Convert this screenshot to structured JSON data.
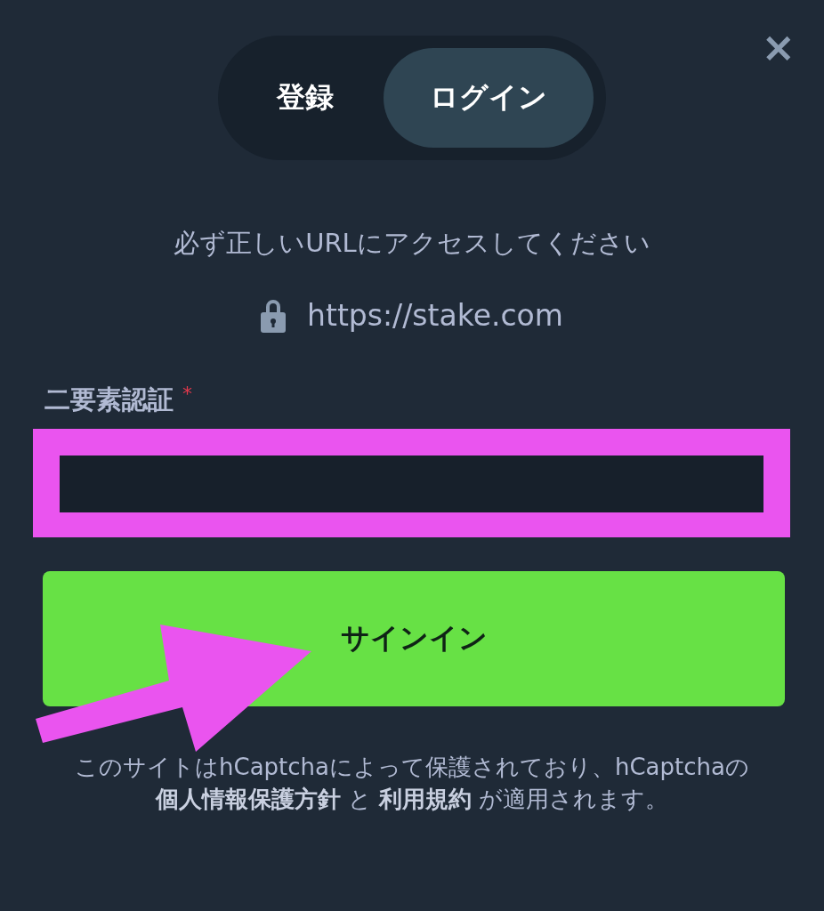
{
  "tabs": [
    {
      "label": "登録",
      "selected": false
    },
    {
      "label": "ログイン",
      "selected": true
    }
  ],
  "close": "×",
  "notice": "必ず正しいURLにアクセスしてください",
  "url": "https://stake.com",
  "field": {
    "label": "二要素認証",
    "required_mark": "*"
  },
  "submit": "サインイン",
  "footer": [
    {
      "kind": "text",
      "text": "このサイトはhCaptchaによって保護されており、hCaptchaの "
    },
    {
      "kind": "link",
      "text": "個人情報保護方針"
    },
    {
      "kind": "text",
      "text": " と "
    },
    {
      "kind": "link",
      "text": "利用規約"
    },
    {
      "kind": "text",
      "text": " が適用されます。"
    }
  ]
}
